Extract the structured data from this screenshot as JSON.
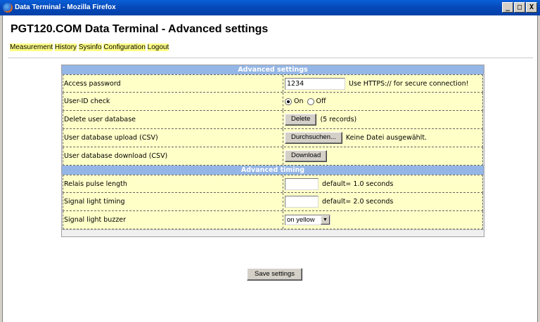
{
  "window": {
    "title": "Data Terminal - Mozilla Firefox",
    "minimize": "_",
    "maximize": "□",
    "close": "X"
  },
  "page": {
    "title": "PGT120.COM Data Terminal - Advanced settings"
  },
  "nav": {
    "items": [
      "Measurement",
      "History",
      "Sysinfo",
      "Configuration",
      "Logout"
    ]
  },
  "advanced_settings": {
    "heading": "Advanced settings",
    "access_password": {
      "label": "Access password",
      "value": "1234",
      "hint": "Use HTTPS:// for secure connection!"
    },
    "user_id_check": {
      "label": "User-ID check",
      "on_label": "On",
      "off_label": "Off",
      "selected": "On"
    },
    "delete_user_db": {
      "label": "Delete user database",
      "button": "Delete",
      "records": "(5 records)"
    },
    "upload_user_db": {
      "label": "User database upload (CSV)",
      "button": "Durchsuchen...",
      "status": "Keine Datei ausgewählt."
    },
    "download_user_db": {
      "label": "User database download (CSV)",
      "button": "Download"
    }
  },
  "advanced_timing": {
    "heading": "Advanced timing",
    "relais_pulse": {
      "label": "Relais pulse length",
      "value": "",
      "hint": "default= 1.0 seconds"
    },
    "signal_light_timing": {
      "label": "Signal light timing",
      "value": "",
      "hint": "default= 2.0 seconds"
    },
    "signal_light_buzzer": {
      "label": "Signal light buzzer",
      "selected": "on yellow"
    }
  },
  "save_button": "Save settings"
}
